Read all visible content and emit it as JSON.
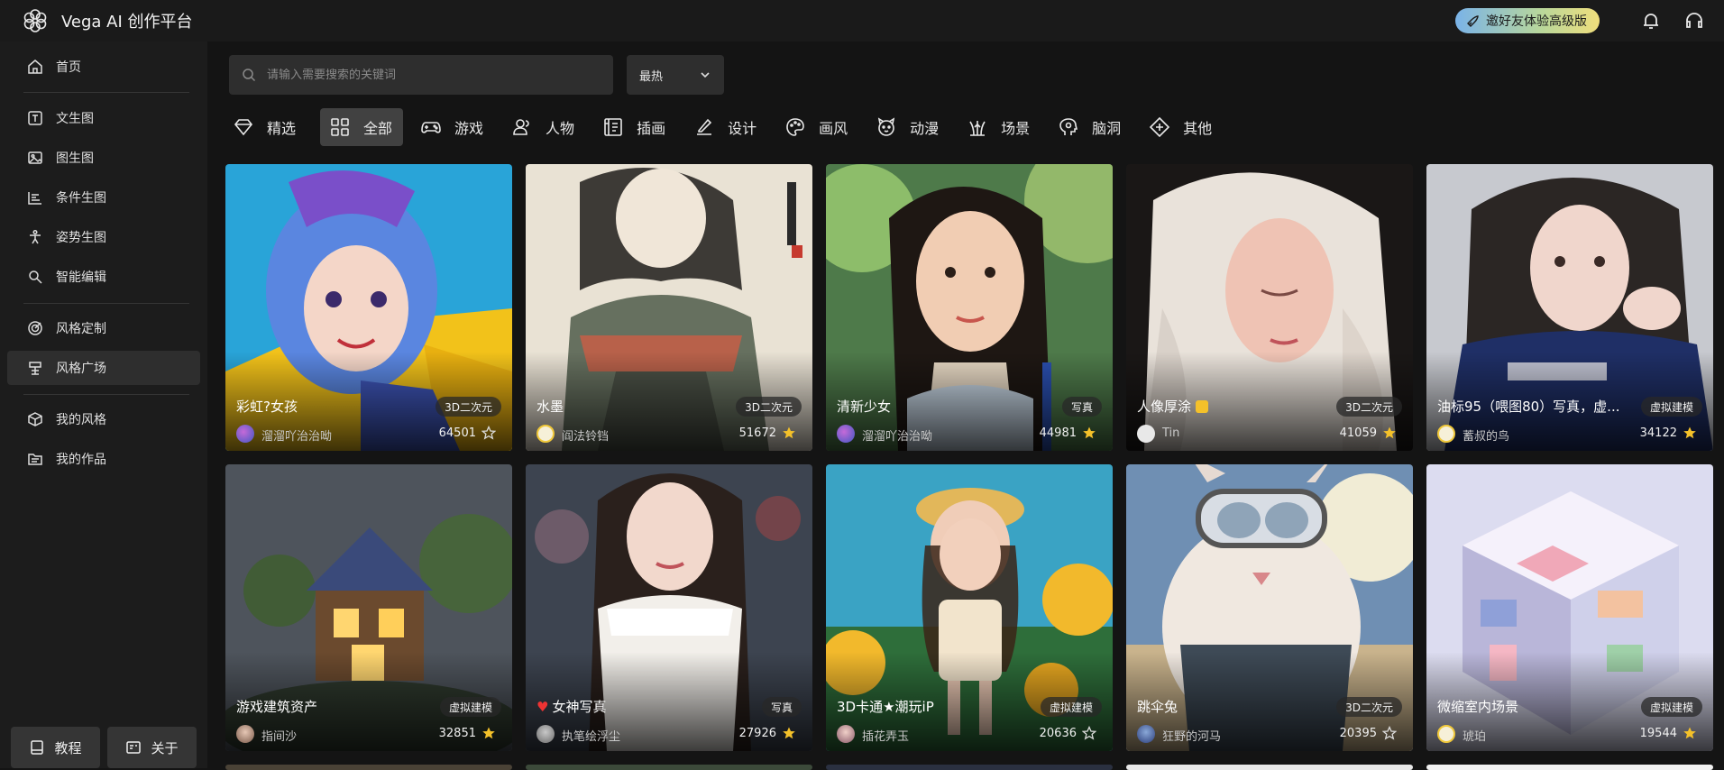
{
  "app": {
    "title": "Vega AI 创作平台"
  },
  "topbar": {
    "invite_label": "邀好友体验高级版"
  },
  "sidebar": {
    "items": [
      {
        "label": "首页",
        "icon": "home-icon"
      },
      {
        "label": "文生图",
        "icon": "text-icon"
      },
      {
        "label": "图生图",
        "icon": "image-icon"
      },
      {
        "label": "条件生图",
        "icon": "condition-icon"
      },
      {
        "label": "姿势生图",
        "icon": "pose-icon"
      },
      {
        "label": "智能编辑",
        "icon": "edit-icon"
      },
      {
        "label": "风格定制",
        "icon": "target-icon"
      },
      {
        "label": "风格广场",
        "icon": "plaza-icon"
      },
      {
        "label": "我的风格",
        "icon": "cube-icon"
      },
      {
        "label": "我的作品",
        "icon": "folder-icon"
      }
    ],
    "active": "风格广场",
    "tutorial_label": "教程",
    "about_label": "关于"
  },
  "search": {
    "placeholder": "请输入需要搜索的关键词"
  },
  "sort": {
    "selected": "最热"
  },
  "categories": [
    {
      "label": "精选",
      "icon": "diamond-icon"
    },
    {
      "label": "全部",
      "icon": "grid-icon",
      "active": true
    },
    {
      "label": "游戏",
      "icon": "gamepad-icon"
    },
    {
      "label": "人物",
      "icon": "person-icon"
    },
    {
      "label": "插画",
      "icon": "illustration-icon"
    },
    {
      "label": "设计",
      "icon": "pen-icon"
    },
    {
      "label": "画风",
      "icon": "palette-icon"
    },
    {
      "label": "动漫",
      "icon": "anime-icon"
    },
    {
      "label": "场景",
      "icon": "scene-icon"
    },
    {
      "label": "脑洞",
      "icon": "brain-icon"
    },
    {
      "label": "其他",
      "icon": "other-icon"
    }
  ],
  "cards": [
    {
      "title": "彩虹?女孩",
      "tag": "3D二次元",
      "author": "溜溜吖治治呦",
      "count": "64501",
      "starred": false
    },
    {
      "title": "水墨",
      "tag": "3D二次元",
      "author": "阎法铃铛",
      "count": "51672",
      "starred": true
    },
    {
      "title": "清新少女",
      "tag": "写真",
      "author": "溜溜吖治治呦",
      "count": "44981",
      "starred": true
    },
    {
      "title": "人像厚涂",
      "tag": "3D二次元",
      "author": "Tin",
      "count": "41059",
      "starred": true
    },
    {
      "title": "油标95（喂图80）写真，虚...",
      "tag": "虚拟建模",
      "author": "蓄叔的鸟",
      "count": "34122",
      "starred": true
    },
    {
      "title": "游戏建筑资产",
      "tag": "虚拟建模",
      "author": "指间沙",
      "count": "32851",
      "starred": true
    },
    {
      "title": "女神写真",
      "tag": "写真",
      "author": "执笔绘浮尘",
      "count": "27926",
      "starred": true
    },
    {
      "title": "3D卡通★潮玩iP",
      "tag": "虚拟建模",
      "author": "插花弄玉",
      "count": "20636",
      "starred": false
    },
    {
      "title": "跳伞兔",
      "tag": "3D二次元",
      "author": "狂野的河马",
      "count": "20395",
      "starred": false
    },
    {
      "title": "微缩室内场景",
      "tag": "虚拟建模",
      "author": "琥珀",
      "count": "19544",
      "starred": true
    }
  ],
  "colors": {
    "star_active": "#f4c12a",
    "background": "#141414",
    "sidebar": "#1c1c1c"
  }
}
